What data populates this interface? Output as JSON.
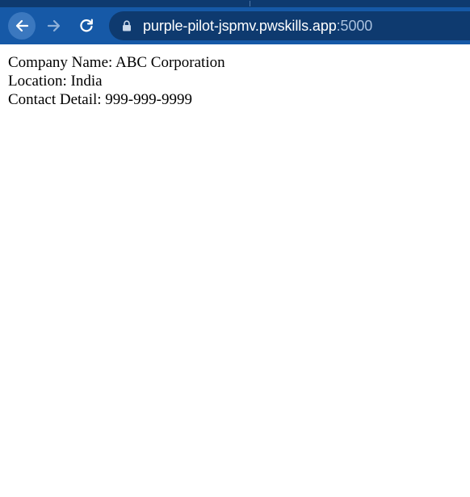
{
  "browser": {
    "address_bar": {
      "host": "purple-pilot-jspmv.pwskills.app",
      "port": ":5000"
    },
    "icons": {
      "back": "back-arrow-icon",
      "forward": "forward-arrow-icon",
      "reload": "reload-icon",
      "lock": "lock-icon"
    },
    "colors": {
      "toolbar": "#1659a7",
      "omnibox": "#0e3a6f"
    }
  },
  "page": {
    "company_name": "Company Name: ABC Corporation",
    "location": "Location: India",
    "contact_detail": "Contact Detail: 999-999-9999"
  }
}
